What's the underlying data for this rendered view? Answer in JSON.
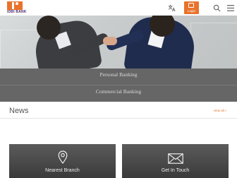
{
  "header": {
    "logo_text": "IDBI BANK",
    "login_label": "Login",
    "icons": [
      "translate-icon",
      "login-lock-icon",
      "search-icon",
      "hamburger-menu-icon"
    ]
  },
  "menu": {
    "items": [
      {
        "label": "Personal Banking"
      },
      {
        "label": "Commercial Banking"
      }
    ]
  },
  "news": {
    "title": "News",
    "view_all": "view all"
  },
  "cards": [
    {
      "label": "Nearest Branch",
      "icon": "location-pin-icon"
    },
    {
      "label": "Get In Touch",
      "icon": "envelope-icon"
    }
  ],
  "colors": {
    "accent": "#e8732c",
    "menu_bg": "#666666",
    "card_bg": "#4a4a4a"
  }
}
